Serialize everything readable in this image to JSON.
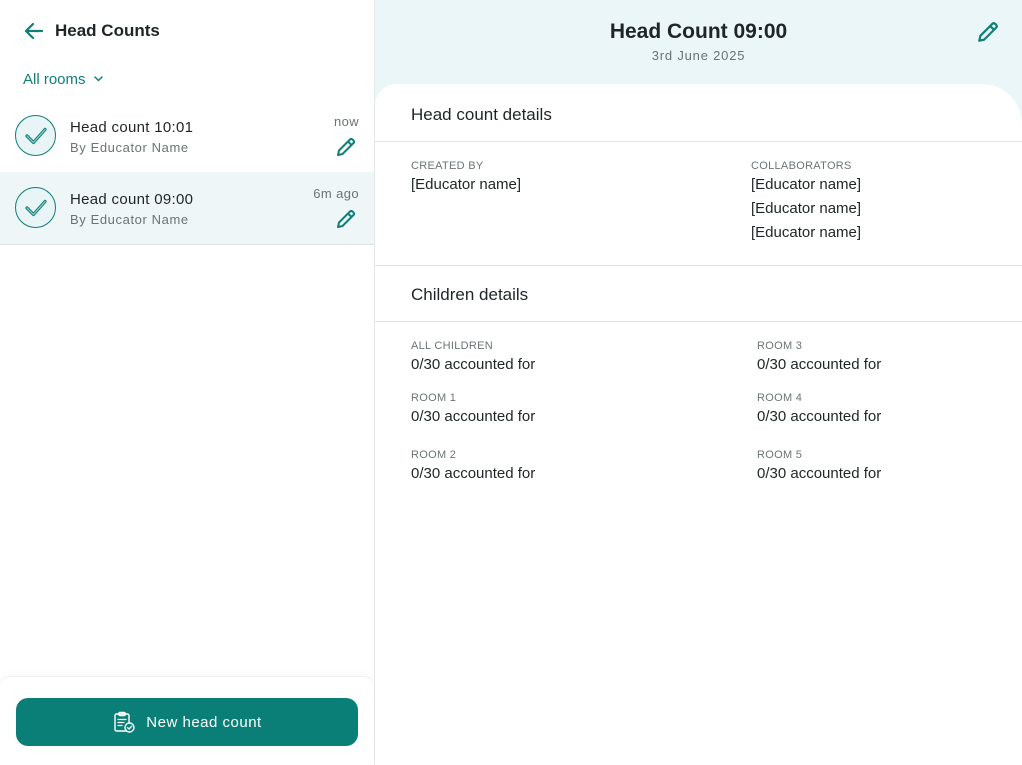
{
  "left": {
    "title": "Head Counts",
    "filter_label": "All rooms",
    "items": [
      {
        "title": "Head count 10:01",
        "subtitle": "By Educator Name",
        "time": "now",
        "selected": false
      },
      {
        "title": "Head count 09:00",
        "subtitle": "By Educator Name",
        "time": "6m ago",
        "selected": true
      }
    ],
    "new_button_label": "New head count"
  },
  "detail": {
    "title": "Head Count 09:00",
    "date": "3rd June 2025",
    "head_count_details": {
      "heading": "Head count details",
      "created_by_label": "CREATED BY",
      "created_by_value": "[Educator name]",
      "collaborators_label": "COLLABORATORS",
      "collaborators": [
        "[Educator name]",
        "[Educator name]",
        "[Educator name]"
      ]
    },
    "children_details": {
      "heading": "Children details",
      "groups": [
        {
          "label": "ALL CHILDREN",
          "value": "0/30 accounted for"
        },
        {
          "label": "ROOM 1",
          "value": "0/30 accounted for"
        },
        {
          "label": "ROOM 2",
          "value": "0/30 accounted for"
        },
        {
          "label": "ROOM 3",
          "value": "0/30 accounted for"
        },
        {
          "label": "ROOM 4",
          "value": "0/30 accounted for"
        },
        {
          "label": "ROOM 5",
          "value": "0/30 accounted for"
        }
      ]
    }
  },
  "colors": {
    "accent": "#0a7f78",
    "panel_bg": "#eaf6f7",
    "selected_bg": "#eef6f7"
  },
  "icons": {
    "back": "arrow-left-icon",
    "filter": "chevron-down-icon",
    "check": "check-icon",
    "edit": "pencil-icon",
    "new": "clipboard-check-icon"
  }
}
